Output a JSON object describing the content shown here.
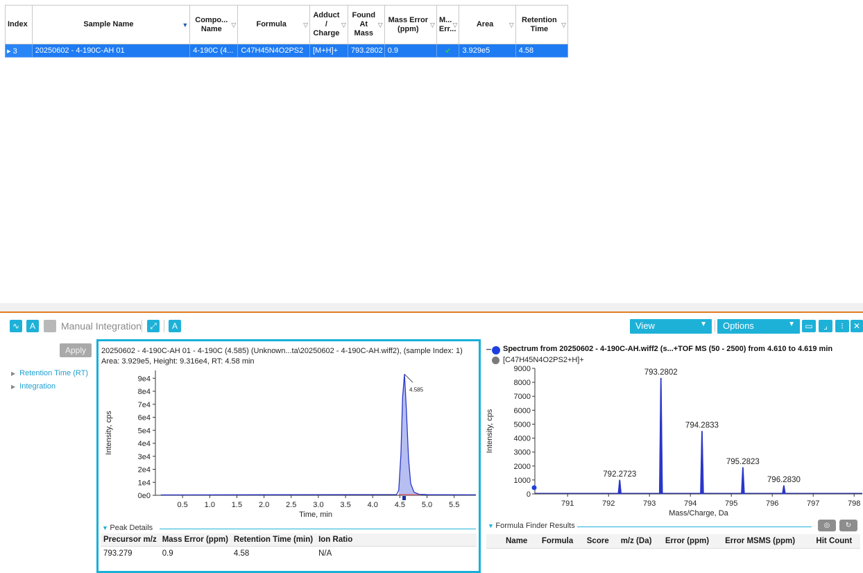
{
  "results_table": {
    "headers": [
      {
        "label": "Index",
        "filter": false
      },
      {
        "label": "Sample Name",
        "filter": true,
        "active": true
      },
      {
        "label": "Compo... Name",
        "filter": true
      },
      {
        "label": "Formula",
        "filter": true
      },
      {
        "label": "Adduct / Charge",
        "filter": true
      },
      {
        "label": "Found At Mass",
        "filter": true
      },
      {
        "label": "Mass Error (ppm)",
        "filter": true
      },
      {
        "label": "M... Err...",
        "filter": true
      },
      {
        "label": "Area",
        "filter": true
      },
      {
        "label": "Retention Time",
        "filter": true
      }
    ],
    "row": {
      "index": "3",
      "sample_name": "20250602 - 4-190C-AH 01",
      "component_name": "4-190C (4...",
      "formula": "C47H45N4O2PS2",
      "adduct": "[M+H]+",
      "found_at_mass": "793.2802",
      "mass_error": "0.9",
      "mass_error_flag": "✔",
      "area": "3.929e5",
      "retention_time": "4.58"
    }
  },
  "toolbar": {
    "manual_integration": "Manual Integration",
    "view": "View",
    "options": "Options"
  },
  "left_panel": {
    "apply": "Apply",
    "items": [
      "Retention Time (RT)",
      "Integration"
    ]
  },
  "chromatogram": {
    "title": "20250602 - 4-190C-AH 01 - 4-190C (4.585) (Unknown...ta\\20250602 - 4-190C-AH.wiff2), (sample Index: 1)",
    "subtitle": "Area: 3.929e5, Height: 9.316e4, RT: 4.58 min",
    "peak_details_label": "Peak Details",
    "peak_details": {
      "headers": [
        "Precursor m/z",
        "Mass Error (ppm)",
        "Retention Time (min)",
        "Ion Ratio"
      ],
      "row": [
        "793.279",
        "0.9",
        "4.58",
        "N/A"
      ]
    }
  },
  "spectrum": {
    "title": "Spectrum from 20250602 - 4-190C-AH.wiff2 (s...+TOF MS (50 - 2500) from 4.610 to 4.619 min",
    "reference": "[C47H45N4O2PS2+H]+",
    "formula_finder_label": "Formula Finder Results",
    "formula_finder_headers": [
      "Name",
      "Formula",
      "Score",
      "m/z (Da)",
      "Error (ppm)",
      "Error MSMS (ppm)",
      "Hit Count"
    ]
  },
  "colors": {
    "accent": "#1eb1d8",
    "selection": "#1e7bf2",
    "trace": "#2a36c8",
    "splitter": "#e07b1f"
  },
  "chart_data": [
    {
      "type": "area",
      "name": "chromatogram",
      "xlabel": "Time, min",
      "ylabel": "Intensity, cps",
      "xlim": [
        0,
        5.9
      ],
      "ylim": [
        0,
        96000
      ],
      "xticks": [
        "0.5",
        "1.0",
        "1.5",
        "2.0",
        "2.5",
        "3.0",
        "3.5",
        "4.0",
        "4.5",
        "5.0",
        "5.5"
      ],
      "yticks": [
        "0e0",
        "1e4",
        "2e4",
        "3e4",
        "4e4",
        "5e4",
        "6e4",
        "7e4",
        "8e4",
        "9e4"
      ],
      "peak": {
        "rt": 4.585,
        "height": 93160,
        "label": "4.585",
        "start": 4.48,
        "end": 4.85
      },
      "points": [
        [
          0.1,
          300
        ],
        [
          4.44,
          600
        ],
        [
          4.48,
          4000
        ],
        [
          4.52,
          32000
        ],
        [
          4.55,
          75000
        ],
        [
          4.585,
          93160
        ],
        [
          4.62,
          66000
        ],
        [
          4.66,
          28000
        ],
        [
          4.7,
          9000
        ],
        [
          4.76,
          2500
        ],
        [
          4.85,
          800
        ],
        [
          5.0,
          500
        ],
        [
          5.9,
          400
        ]
      ]
    },
    {
      "type": "bar",
      "name": "spectrum",
      "xlabel": "Mass/Charge, Da",
      "ylabel": "Intensity, cps",
      "xlim": [
        790.2,
        798.2
      ],
      "ylim": [
        0,
        9000
      ],
      "xticks": [
        "791",
        "792",
        "793",
        "794",
        "795",
        "796",
        "797",
        "798"
      ],
      "yticks": [
        "0",
        "1000",
        "2000",
        "3000",
        "4000",
        "5000",
        "6000",
        "7000",
        "8000",
        "9000"
      ],
      "peaks": [
        {
          "mz": 792.2723,
          "intensity": 1000,
          "label": "792.2723"
        },
        {
          "mz": 793.2802,
          "intensity": 8300,
          "label": "793.2802"
        },
        {
          "mz": 794.2833,
          "intensity": 4500,
          "label": "794.2833"
        },
        {
          "mz": 795.2823,
          "intensity": 1900,
          "label": "795.2823"
        },
        {
          "mz": 796.283,
          "intensity": 600,
          "label": "796.2830"
        }
      ]
    }
  ]
}
